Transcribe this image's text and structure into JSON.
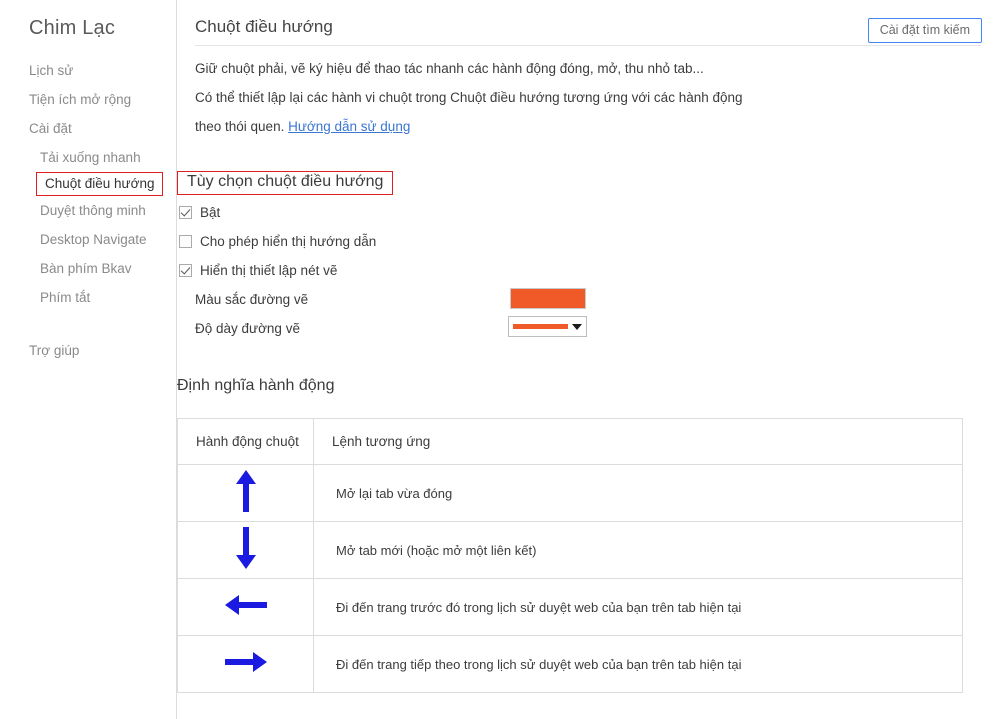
{
  "brand": "Chim Lạc",
  "colors": {
    "accent_orange": "#F05A28",
    "arrow_blue": "#1A1AE0",
    "highlight_red": "#E02020",
    "button_border_blue": "#4285F4"
  },
  "sidebar": {
    "items": [
      {
        "label": "Lịch sử",
        "level": "top",
        "selected": false
      },
      {
        "label": "Tiện ích mở rộng",
        "level": "top",
        "selected": false
      },
      {
        "label": "Cài đặt",
        "level": "top",
        "selected": false
      },
      {
        "label": "Tải xuống nhanh",
        "level": "sub",
        "selected": false
      },
      {
        "label": "Chuột điều hướng",
        "level": "sub",
        "selected": true
      },
      {
        "label": "Duyệt thông minh",
        "level": "sub",
        "selected": false
      },
      {
        "label": "Desktop Navigate",
        "level": "sub",
        "selected": false
      },
      {
        "label": "Bàn phím Bkav",
        "level": "sub",
        "selected": false
      },
      {
        "label": "Phím tắt",
        "level": "sub",
        "selected": false
      }
    ],
    "help_label": "Trợ giúp"
  },
  "header": {
    "title": "Chuột điều hướng",
    "search_settings_label": "Cài đặt tìm kiếm"
  },
  "description": {
    "line1": "Giữ chuột phải, vẽ ký hiệu để thao tác nhanh các hành động đóng, mở, thu nhỏ tab...",
    "line2": "Có thể thiết lập lại các hành vi chuột trong Chuột điều hướng tương ứng với các hành động",
    "line3_prefix": "theo thói quen. ",
    "line3_link": "Hướng dẫn sử dụng"
  },
  "options": {
    "section_title": "Tùy chọn chuột điều hướng",
    "items": [
      {
        "label": "Bật",
        "checked": true
      },
      {
        "label": "Cho phép hiển thị hướng dẫn",
        "checked": false
      },
      {
        "label": "Hiển thị thiết lập nét vẽ",
        "checked": true
      }
    ],
    "stroke_color_label": "Màu sắc đường vẽ",
    "stroke_color_value": "#F05A28",
    "stroke_width_label": "Độ dày đường vẽ",
    "stroke_width_value": "5"
  },
  "actions": {
    "section_title": "Định nghĩa hành động",
    "columns": [
      "Hành động chuột",
      "Lệnh tương ứng"
    ],
    "rows": [
      {
        "gesture": "arrow-up-icon",
        "command": "Mở lại tab vừa đóng"
      },
      {
        "gesture": "arrow-down-icon",
        "command": "Mở tab mới (hoặc mở một liên kết)"
      },
      {
        "gesture": "arrow-left-icon",
        "command": "Đi đến trang trước đó trong lịch sử duyệt web của bạn trên tab hiện tại"
      },
      {
        "gesture": "arrow-right-icon",
        "command": "Đi đến trang tiếp theo trong lịch sử duyệt web của bạn trên tab hiện tại"
      }
    ]
  }
}
